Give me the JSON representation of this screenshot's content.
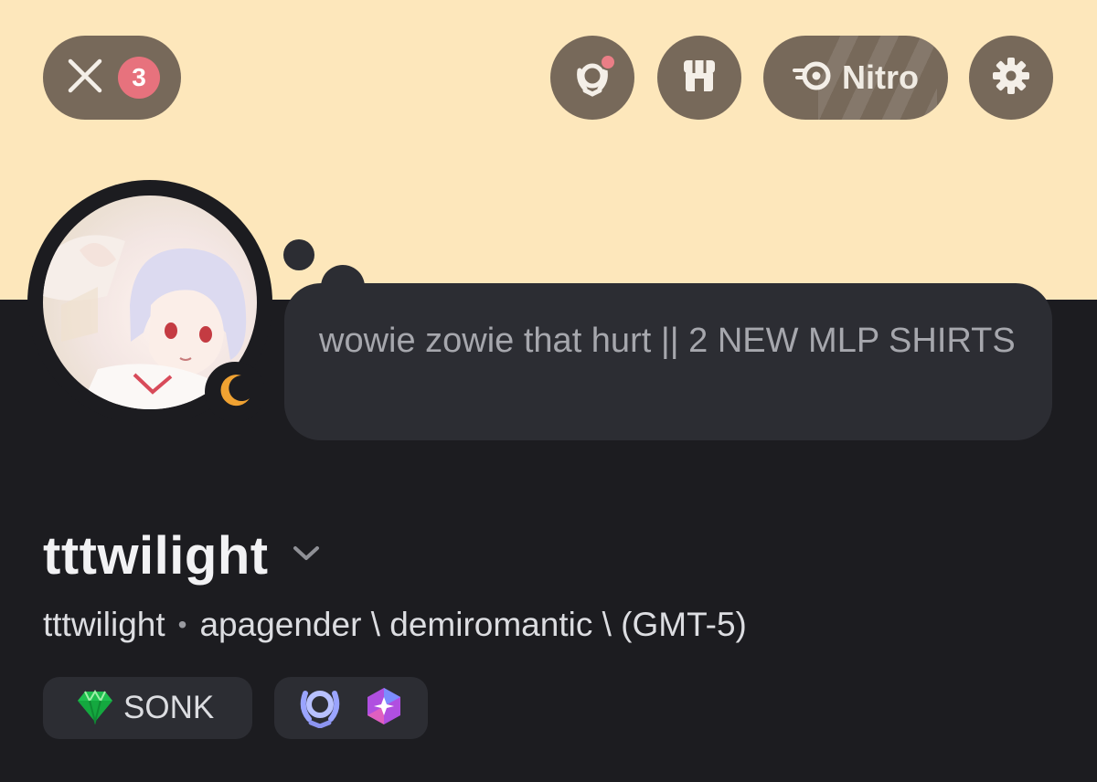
{
  "header": {
    "notification_count": "3",
    "nitro_label": "Nitro",
    "icons": {
      "close": "close-icon",
      "quests": "quests-icon",
      "shop": "shop-icon",
      "nitro": "nitro-icon",
      "settings": "gear-icon"
    }
  },
  "profile": {
    "status_message": "wowie zowie that hurt || 2 NEW MLP SHIRTS",
    "display_name": "tttwilight",
    "username": "tttwilight",
    "separator": "•",
    "pronouns_bio": "apagender \\ demiromantic \\ (GMT-5)",
    "presence": "idle",
    "server_tag": "SONK",
    "badges": [
      "quest-badge-icon",
      "nitro-gem-badge-icon"
    ]
  },
  "colors": {
    "banner": "#fde7bb",
    "background": "#1c1c20",
    "button": "#77695a",
    "badge_red": "#e7727d",
    "idle_moon": "#f0a232"
  }
}
